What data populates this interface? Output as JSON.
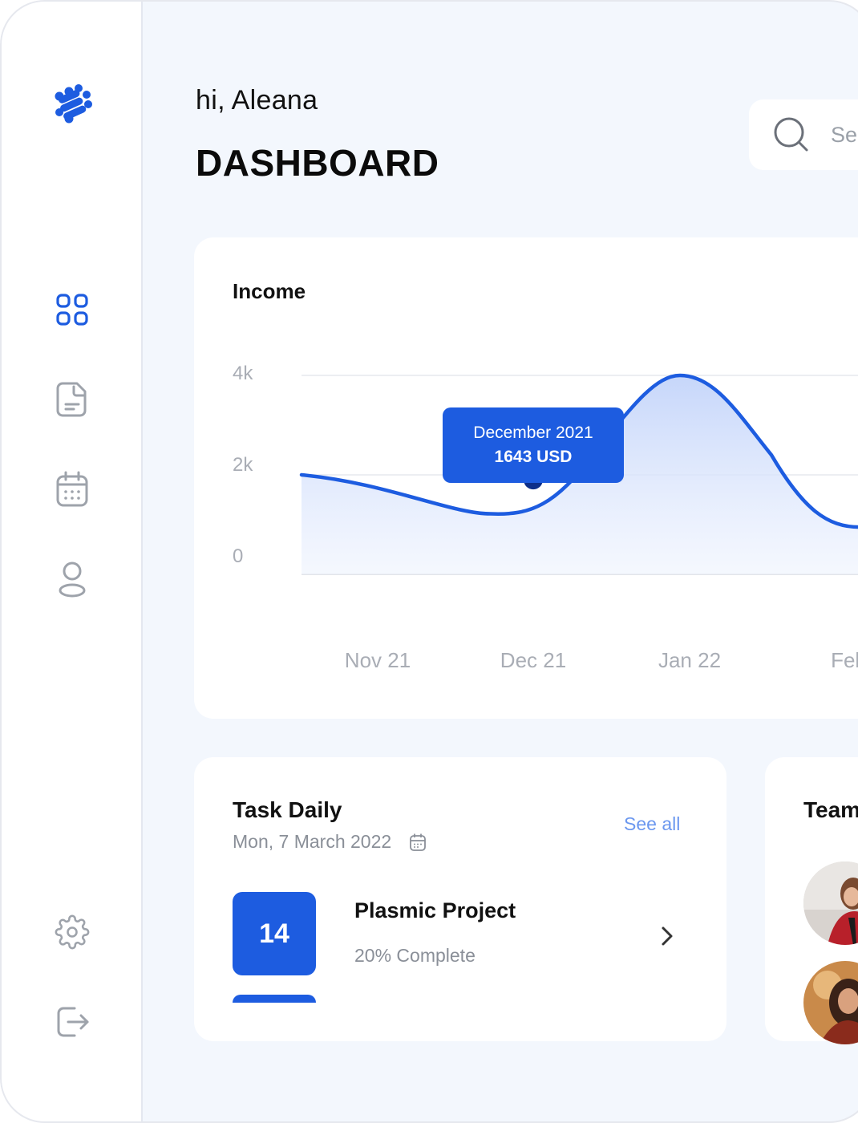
{
  "header": {
    "greeting": "hi, Aleana",
    "title": "DASHBOARD",
    "search_placeholder": "Sea"
  },
  "sidebar": {
    "items": [
      {
        "icon": "grid-icon",
        "active": true
      },
      {
        "icon": "document-icon",
        "active": false
      },
      {
        "icon": "calendar-icon",
        "active": false
      },
      {
        "icon": "user-icon",
        "active": false
      }
    ],
    "bottom": [
      {
        "icon": "gear-icon"
      },
      {
        "icon": "logout-icon"
      }
    ]
  },
  "income": {
    "title": "Income",
    "tooltip": {
      "line1": "December 2021",
      "line2": "1643 USD"
    }
  },
  "chart_data": {
    "type": "area",
    "title": "Income",
    "x": [
      "Nov 21",
      "Dec 21",
      "Jan 22",
      "Feb"
    ],
    "y_ticks": [
      "4k",
      "2k",
      "0"
    ],
    "ylim": [
      0,
      4000
    ],
    "series": [
      {
        "values": [
          2000,
          1643,
          4000,
          950
        ]
      }
    ],
    "highlight": {
      "x": "Dec 21",
      "value": 1643,
      "label": "December 2021",
      "unit": "USD"
    },
    "colors": {
      "line": "#1d5ce0",
      "area": "#cfdcfb",
      "point": "#0d2f8a"
    },
    "grid": true,
    "legend": "none"
  },
  "task_daily": {
    "title": "Task Daily",
    "date": "Mon, 7 March 2022",
    "see_all": "See all",
    "tasks": [
      {
        "day": "14",
        "name": "Plasmic Project",
        "progress": "20% Complete"
      }
    ]
  },
  "team": {
    "title": "Team"
  },
  "colors": {
    "accent": "#1d5ce0",
    "background": "#f3f7fd",
    "muted": "#a9adb5",
    "link": "#6b97ef"
  }
}
